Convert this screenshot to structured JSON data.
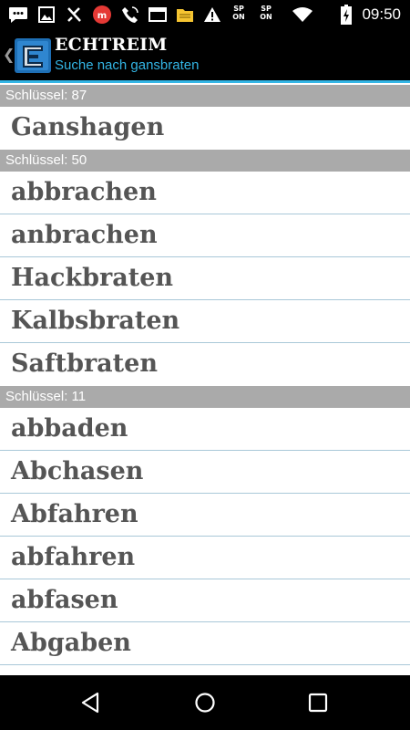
{
  "status_bar": {
    "time": "09:50",
    "sp_badges": [
      "SP\nON",
      "SP\nON"
    ],
    "icons": [
      "chat-icon",
      "image-icon",
      "tools-icon",
      "app-icon",
      "phone-icon",
      "window-icon",
      "folder-icon",
      "warning-icon",
      "sp-on-icon",
      "sp-on-icon",
      "wifi-icon",
      "battery-icon"
    ]
  },
  "action_bar": {
    "title": "ECHTREIM",
    "subtitle": "Suche nach gansbraten",
    "accent_color": "#33b5e5"
  },
  "sections": [
    {
      "header": "Schlüssel: 87",
      "items": [
        "Ganshagen"
      ]
    },
    {
      "header": "Schlüssel: 50",
      "items": [
        "abbrachen",
        "anbrachen",
        "Hackbraten",
        "Kalbsbraten",
        "Saftbraten"
      ]
    },
    {
      "header": "Schlüssel: 11",
      "items": [
        "abbaden",
        "Abchasen",
        "Abfahren",
        "abfahren",
        "abfasen",
        "Abgaben",
        ""
      ]
    }
  ],
  "nav_bar": {
    "icons": [
      "back-icon",
      "home-icon",
      "recent-apps-icon"
    ]
  }
}
